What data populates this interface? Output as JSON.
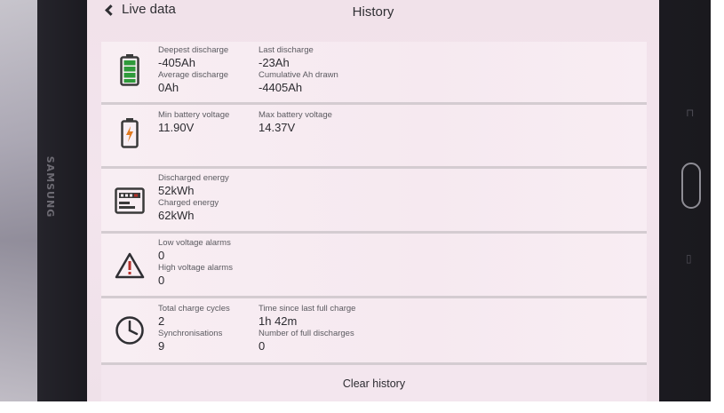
{
  "device": {
    "brand": "SAMSUNG"
  },
  "header": {
    "back_label": "Live data",
    "title": "History"
  },
  "sections": {
    "discharge": {
      "deepest_label": "Deepest discharge",
      "deepest_value": "-405Ah",
      "last_label": "Last discharge",
      "last_value": "-23Ah",
      "average_label": "Average discharge",
      "average_value": "0Ah",
      "cumulative_label": "Cumulative Ah drawn",
      "cumulative_value": "-4405Ah"
    },
    "voltage": {
      "min_label": "Min battery voltage",
      "min_value": "11.90V",
      "max_label": "Max battery voltage",
      "max_value": "14.37V"
    },
    "energy": {
      "discharged_label": "Discharged energy",
      "discharged_value": "52kWh",
      "charged_label": "Charged energy",
      "charged_value": "62kWh"
    },
    "alarms": {
      "low_label": "Low voltage alarms",
      "low_value": "0",
      "high_label": "High voltage alarms",
      "high_value": "0"
    },
    "cycles": {
      "total_label": "Total charge cycles",
      "total_value": "2",
      "time_label": "Time since last full charge",
      "time_value": "1h 42m",
      "sync_label": "Synchronisations",
      "sync_value": "9",
      "full_label": "Number of full discharges",
      "full_value": "0"
    }
  },
  "footer": {
    "clear_label": "Clear history"
  },
  "icons": {
    "battery": "battery-full-icon",
    "battery_charging": "battery-charging-icon",
    "energy_meter": "energy-meter-icon",
    "warning": "warning-icon",
    "clock": "clock-icon"
  },
  "colors": {
    "battery_green": "#2e9a3a",
    "charge_bolt": "#e07a1f",
    "warning_red": "#b5312b"
  }
}
